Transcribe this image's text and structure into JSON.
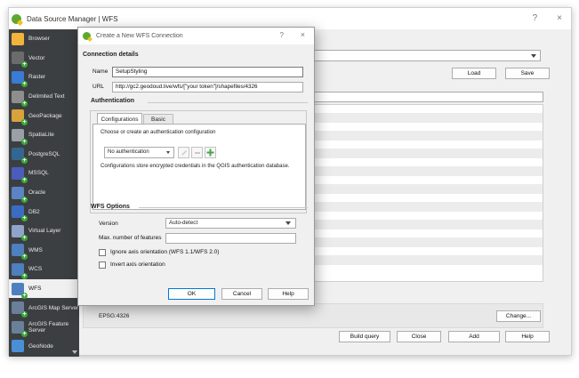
{
  "window": {
    "title": "Data Source Manager | WFS",
    "help_symbol": "?",
    "close_symbol": "×"
  },
  "sidebar": {
    "items": [
      {
        "label": "Browser",
        "icon": "folder-icon",
        "color": "#f2b43c",
        "plus": false
      },
      {
        "label": "Vector",
        "icon": "vector-icon",
        "color": "#6b6b6b",
        "plus": true
      },
      {
        "label": "Raster",
        "icon": "raster-icon",
        "color": "#3a7bd5",
        "plus": true
      },
      {
        "label": "Delimited Text",
        "icon": "delimited-text-icon",
        "color": "#8e8e8e",
        "plus": true
      },
      {
        "label": "GeoPackage",
        "icon": "geopackage-icon",
        "color": "#d9a23a",
        "plus": true
      },
      {
        "label": "SpatiaLite",
        "icon": "spatialite-icon",
        "color": "#9aa0a6",
        "plus": true
      },
      {
        "label": "PostgreSQL",
        "icon": "postgresql-icon",
        "color": "#336791",
        "plus": true
      },
      {
        "label": "MSSQL",
        "icon": "mssql-icon",
        "color": "#4a5dbd",
        "plus": true
      },
      {
        "label": "Oracle",
        "icon": "oracle-icon",
        "color": "#5c84c4",
        "plus": true
      },
      {
        "label": "DB2",
        "icon": "db2-icon",
        "color": "#3b6cc4",
        "plus": true
      },
      {
        "label": "Virtual Layer",
        "icon": "virtual-layer-icon",
        "color": "#8fa4c8",
        "plus": true
      },
      {
        "label": "WMS",
        "icon": "wms-icon",
        "color": "#4e7fbf",
        "plus": true
      },
      {
        "label": "WCS",
        "icon": "wcs-icon",
        "color": "#4e7fbf",
        "plus": true
      },
      {
        "label": "WFS",
        "icon": "wfs-icon",
        "color": "#4e7fbf",
        "plus": true
      },
      {
        "label": "ArcGIS Map Server",
        "icon": "arcgis-map-server-icon",
        "color": "#6a7f99",
        "plus": true
      },
      {
        "label": "ArcGIS Feature Server",
        "icon": "arcgis-feature-server-icon",
        "color": "#6a7f99",
        "plus": true
      },
      {
        "label": "GeoNode",
        "icon": "geonode-icon",
        "color": "#4a8fd6",
        "plus": false
      }
    ],
    "active_index": 13
  },
  "main": {
    "load_label": "Load",
    "save_label": "Save",
    "crs_value": "EPSG:4326",
    "change_label": "Change...",
    "build_query_label": "Build query",
    "close_label": "Close",
    "add_label": "Add",
    "help_label": "Help"
  },
  "dialog": {
    "title": "Create a New WFS Connection",
    "help_symbol": "?",
    "close_symbol": "×",
    "connection_details_title": "Connection details",
    "name_label": "Name",
    "name_value": "SetupStyling",
    "url_label": "URL",
    "url_value": "http://gc2.geodoud.live/wfs/[\"your token\"]/shapefiles/4326",
    "authentication_title": "Authentication",
    "tabs": [
      {
        "label": "Configurations",
        "active": true
      },
      {
        "label": "Basic",
        "active": false
      }
    ],
    "auth_prompt": "Choose or create an authentication configuration",
    "auth_select_value": "No authentication",
    "auth_note": "Configurations store encrypted credentials in the QGIS authentication database.",
    "wfs_options_title": "WFS Options",
    "version_label": "Version",
    "version_value": "Auto-detect",
    "max_features_label": "Max. number of features",
    "max_features_value": "",
    "ignore_axis_label": "Ignore axis orientation (WFS 1.1/WFS 2.0)",
    "invert_axis_label": "Invert axis orientation",
    "ok_label": "OK",
    "cancel_label": "Cancel",
    "help_label": "Help"
  }
}
